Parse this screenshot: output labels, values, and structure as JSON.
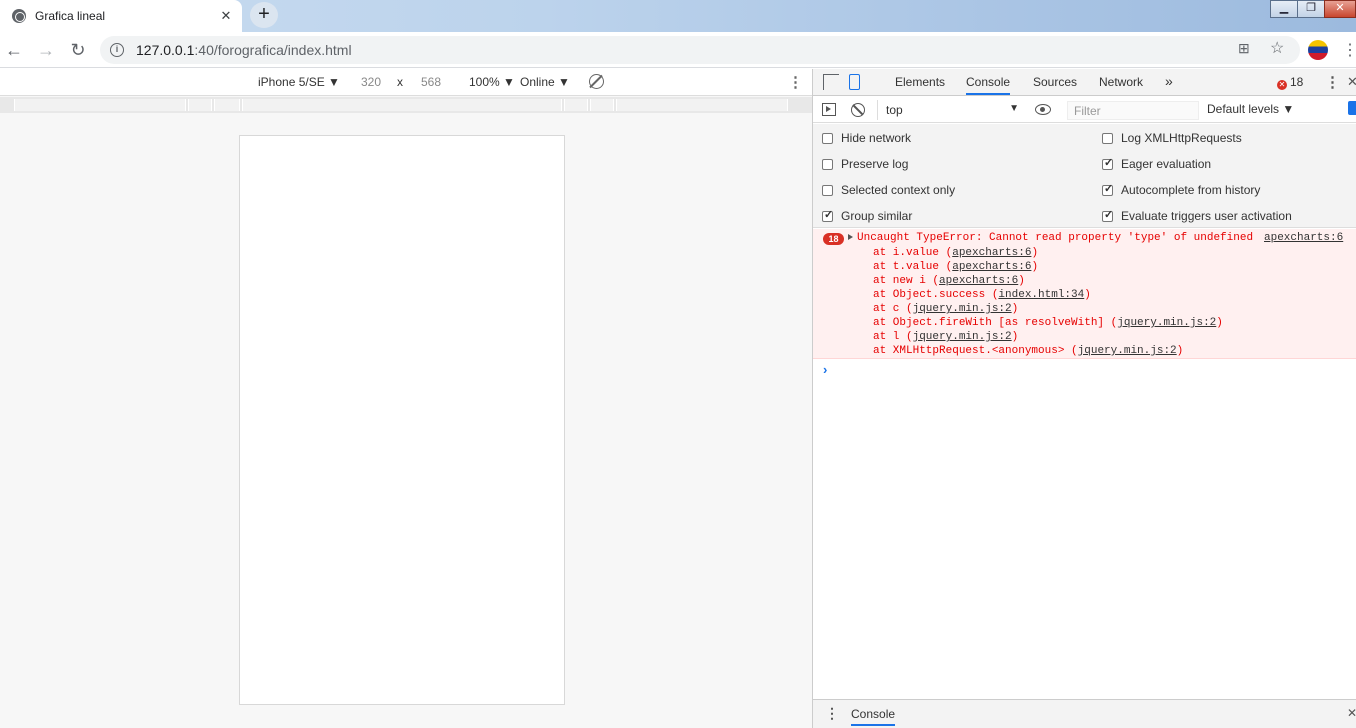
{
  "browser": {
    "tab_title": "Grafica lineal",
    "tab_close": "✕",
    "new_tab": "+",
    "url_host": "127.0.0.1",
    "url_path": ":40/forografica/index.html",
    "window_buttons": [
      "▁",
      "❐",
      "✕"
    ]
  },
  "device_toolbar": {
    "device": "iPhone 5/SE ▼",
    "width": "320",
    "times": "x",
    "height": "568",
    "zoom": "100% ▼",
    "network": "Online ▼",
    "more": "⋮"
  },
  "devtools": {
    "tabs": [
      "Elements",
      "Console",
      "Sources",
      "Network"
    ],
    "more_tabs": "»",
    "error_count": "18",
    "context": "top",
    "filter_placeholder": "Filter",
    "levels": "Default levels ▼",
    "settings_left": [
      {
        "label": "Hide network",
        "checked": false
      },
      {
        "label": "Preserve log",
        "checked": false
      },
      {
        "label": "Selected context only",
        "checked": false
      },
      {
        "label": "Group similar",
        "checked": true
      }
    ],
    "settings_right": [
      {
        "label": "Log XMLHttpRequests",
        "checked": false
      },
      {
        "label": "Eager evaluation",
        "checked": true
      },
      {
        "label": "Autocomplete from history",
        "checked": true
      },
      {
        "label": "Evaluate triggers user activation",
        "checked": true
      }
    ],
    "error": {
      "badge": "18",
      "message": "Uncaught TypeError: Cannot read property 'type' of undefined",
      "source": "apexcharts:6",
      "trace": [
        {
          "pre": "at i.value (",
          "link": "apexcharts:6",
          "post": ")"
        },
        {
          "pre": "at t.value (",
          "link": "apexcharts:6",
          "post": ")"
        },
        {
          "pre": "at new i (",
          "link": "apexcharts:6",
          "post": ")"
        },
        {
          "pre": "at Object.success (",
          "link": "index.html:34",
          "post": ")"
        },
        {
          "pre": "at c (",
          "link": "jquery.min.js:2",
          "post": ")"
        },
        {
          "pre": "at Object.fireWith [as resolveWith] (",
          "link": "jquery.min.js:2",
          "post": ")"
        },
        {
          "pre": "at l (",
          "link": "jquery.min.js:2",
          "post": ")"
        },
        {
          "pre": "at XMLHttpRequest.<anonymous> (",
          "link": "jquery.min.js:2",
          "post": ")"
        }
      ]
    },
    "prompt": "›",
    "drawer_tab": "Console"
  },
  "colors": {
    "error": "#e60000",
    "accent": "#1a73e8",
    "error_bg": "#fff0f0"
  }
}
